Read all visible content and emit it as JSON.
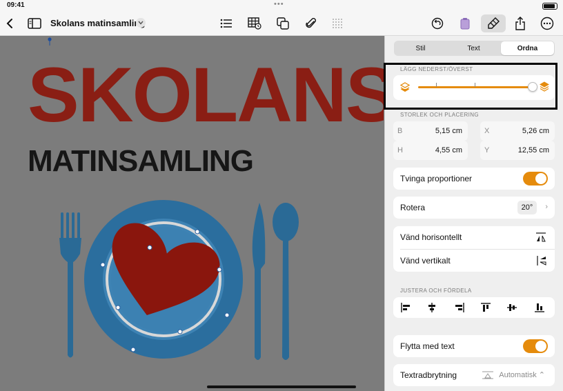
{
  "status": {
    "time": "09:41"
  },
  "toolbar": {
    "doc_title": "Skolans matinsamling",
    "icons": [
      "back-icon",
      "sidebar-icon",
      "chevron-down-icon",
      "list-icon",
      "table-icon",
      "shapes-icon",
      "paperclip-icon",
      "grid-icon",
      "undo-icon",
      "collab-icon",
      "format-brush-icon",
      "share-icon",
      "more-icon"
    ]
  },
  "canvas": {
    "title": "SKOLANS",
    "subtitle": "MATINSAMLING"
  },
  "inspector": {
    "tabs": [
      {
        "label": "Stil",
        "active": false
      },
      {
        "label": "Text",
        "active": false
      },
      {
        "label": "Ordna",
        "active": true
      }
    ],
    "layer": {
      "label": "LÄGG NEDERST/ÖVERST",
      "level": 0.95
    },
    "size_pos": {
      "label": "STORLEK OCH PLACERING",
      "b_label": "B",
      "b_value": "5,15 cm",
      "h_label": "H",
      "h_value": "4,55 cm",
      "x_label": "X",
      "x_value": "5,26 cm",
      "y_label": "Y",
      "y_value": "12,55 cm"
    },
    "constrain": {
      "label": "Tvinga proportioner",
      "on": true
    },
    "rotate": {
      "label": "Rotera",
      "value": "20°"
    },
    "flip_h": "Vänd horisontellt",
    "flip_v": "Vänd vertikalt",
    "align": {
      "label": "JUSTERA OCH FÖRDELA"
    },
    "move_with_text": {
      "label": "Flytta med text",
      "on": true
    },
    "wrap": {
      "label": "Textradbrytning",
      "value": "Automatisk"
    }
  },
  "colors": {
    "accent": "#e58b0c",
    "title_red": "#8a1e14",
    "plate_blue": "#1f5a86",
    "heart_red": "#8a160d"
  }
}
